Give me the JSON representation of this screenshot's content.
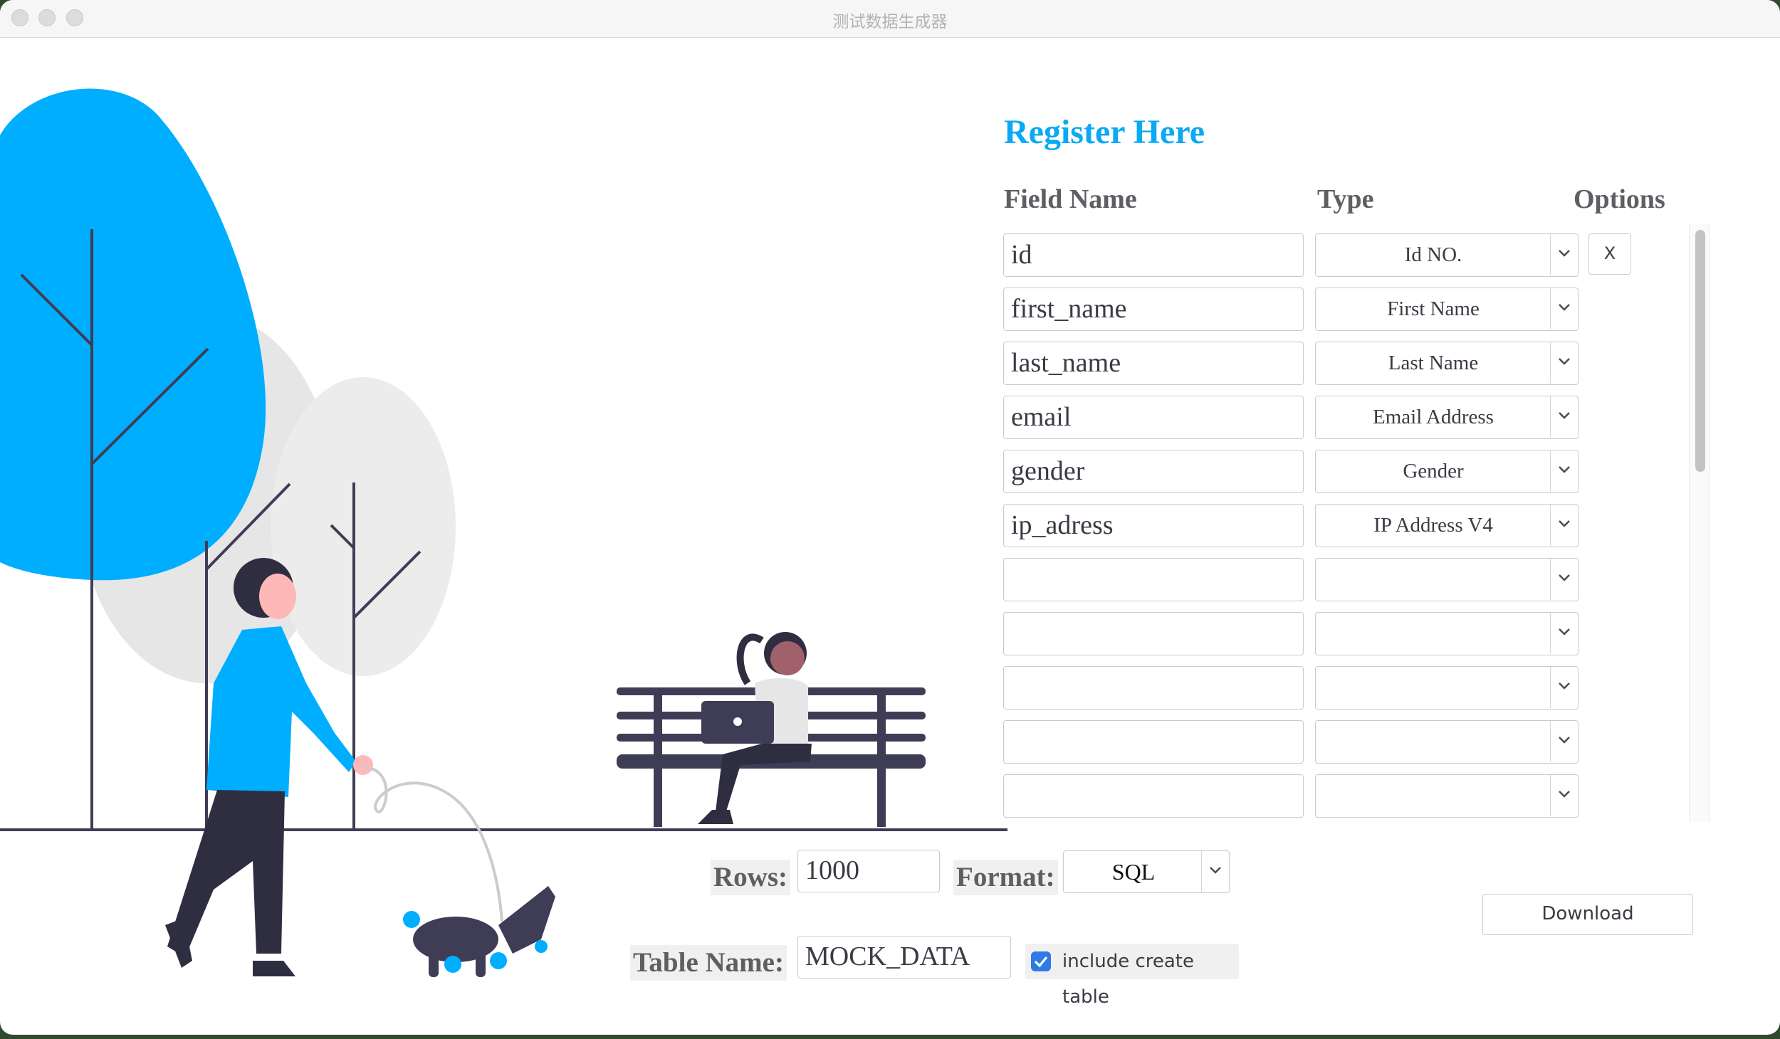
{
  "window": {
    "title": "测试数据生成器"
  },
  "form": {
    "heading": "Register Here",
    "columns": {
      "field_name": "Field Name",
      "type": "Type",
      "options": "Options"
    },
    "rows": [
      {
        "field": "id",
        "type": "Id NO.",
        "option": "X"
      },
      {
        "field": "first_name",
        "type": "First Name"
      },
      {
        "field": "last_name",
        "type": "Last Name"
      },
      {
        "field": "email",
        "type": "Email Address"
      },
      {
        "field": "gender",
        "type": "Gender"
      },
      {
        "field": "ip_adress",
        "type": "IP Address V4"
      },
      {
        "field": "",
        "type": ""
      },
      {
        "field": "",
        "type": ""
      },
      {
        "field": "",
        "type": ""
      },
      {
        "field": "",
        "type": ""
      },
      {
        "field": "",
        "type": ""
      }
    ]
  },
  "settings": {
    "rows_label": "Rows:",
    "rows_value": "1000",
    "format_label": "Format:",
    "format_value": "SQL",
    "table_name_label": "Table Name:",
    "table_name_value": "MOCK_DATA",
    "include_create_table_label": "include create table",
    "include_create_table_checked": true,
    "download_label": "Download"
  },
  "colors": {
    "accent": "#0aa9f4",
    "checkbox": "#2f7ae5",
    "label_text": "#5e5e63"
  }
}
